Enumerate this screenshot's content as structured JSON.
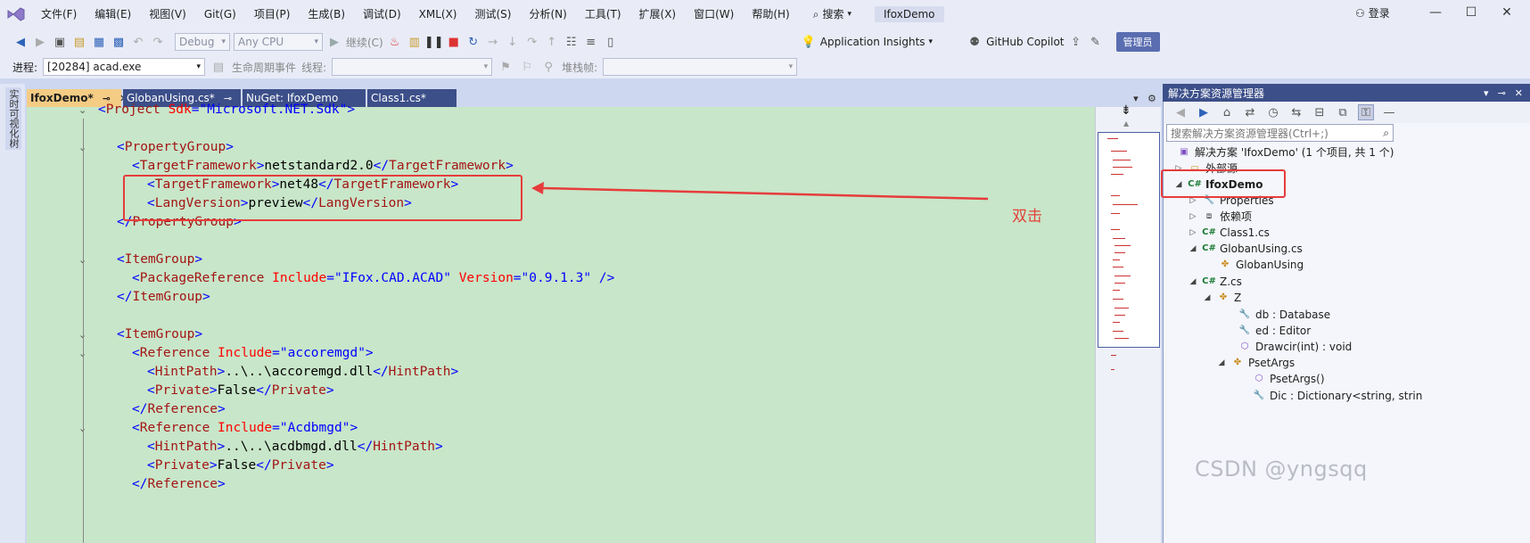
{
  "menubar": {
    "items": [
      "文件(F)",
      "编辑(E)",
      "视图(V)",
      "Git(G)",
      "项目(P)",
      "生成(B)",
      "调试(D)",
      "XML(X)",
      "测试(S)",
      "分析(N)",
      "工具(T)",
      "扩展(X)",
      "窗口(W)",
      "帮助(H)"
    ],
    "search_label": "搜索",
    "solution_title": "IfoxDemo",
    "login_label": "登录"
  },
  "toolbar1": {
    "config": "Debug",
    "platform": "Any CPU",
    "continue_label": "继续(C)",
    "insights_label": "Application Insights",
    "copilot_label": "GitHub Copilot",
    "admin_label": "管理员"
  },
  "toolbar2": {
    "process_label": "进程:",
    "process_value": "[20284] acad.exe",
    "lifecycle_label": "生命周期事件",
    "thread_label": "线程:",
    "stack_label": "堆栈帧:"
  },
  "left_strip": {
    "label": "实时可视化树"
  },
  "tabs": [
    {
      "label": "IfoxDemo*",
      "active": true
    },
    {
      "label": "GlobanUsing.cs*",
      "active": false
    },
    {
      "label": "NuGet: IfoxDemo",
      "active": false
    },
    {
      "label": "Class1.cs*",
      "active": false
    }
  ],
  "code": {
    "l1_tag": "Project",
    "l1_attr": "Sdk",
    "l1_val": "\"Microsoft.NET.Sdk\"",
    "l3_tag": "PropertyGroup",
    "l4_tag": "TargetFramework",
    "l4_text": "netstandard2.0",
    "l5_tag": "TargetFramework",
    "l5_text": "net48",
    "l6_tag": "LangVersion",
    "l6_text": "preview",
    "l7_tag": "PropertyGroup",
    "l9_tag": "ItemGroup",
    "l10_tag": "PackageReference",
    "l10_attr1": "Include",
    "l10_val1": "\"IFox.CAD.ACAD\"",
    "l10_attr2": "Version",
    "l10_val2": "\"0.9.1.3\"",
    "l11_tag": "ItemGroup",
    "l13_tag": "ItemGroup",
    "l14_tag": "Reference",
    "l14_attr": "Include",
    "l14_val": "\"accoremgd\"",
    "l15_tag": "HintPath",
    "l15_text": "..\\..\\accoremgd.dll",
    "l16_tag": "Private",
    "l16_text": "False",
    "l17_tag": "Reference",
    "l18_tag": "Reference",
    "l18_attr": "Include",
    "l18_val": "\"Acdbmgd\"",
    "l19_tag": "HintPath",
    "l19_text": "..\\..\\acdbmgd.dll",
    "l20_tag": "Private",
    "l20_text": "False",
    "l21_tag": "Reference"
  },
  "solution_explorer": {
    "title": "解决方案资源管理器",
    "search_placeholder": "搜索解决方案资源管理器(Ctrl+;)",
    "items": [
      {
        "label": "解决方案 'IfoxDemo' (1 个项目, 共 1 个)",
        "icon": "solution-icon"
      },
      {
        "label": "外部源",
        "icon": "folder-icon"
      },
      {
        "label": "IfoxDemo",
        "icon": "csproj-icon"
      },
      {
        "label": "Properties",
        "icon": "wrench-icon"
      },
      {
        "label": "依赖项",
        "icon": "dependencies-icon"
      },
      {
        "label": "Class1.cs",
        "icon": "csharp-file-icon"
      },
      {
        "label": "GlobanUsing.cs",
        "icon": "csharp-file-icon"
      },
      {
        "label": "GlobanUsing",
        "icon": "class-icon"
      },
      {
        "label": "Z.cs",
        "icon": "csharp-file-icon"
      },
      {
        "label": "Z",
        "icon": "class-icon"
      },
      {
        "label": "db : Database",
        "icon": "property-icon"
      },
      {
        "label": "ed : Editor",
        "icon": "property-icon"
      },
      {
        "label": "Drawcir(int) : void",
        "icon": "method-icon"
      },
      {
        "label": "PsetArgs",
        "icon": "class-icon"
      },
      {
        "label": "PsetArgs()",
        "icon": "method-icon"
      },
      {
        "label": "Dic : Dictionary<string, strin",
        "icon": "property-icon"
      }
    ]
  },
  "annotation": {
    "text": "双击"
  },
  "watermark": "CSDN @yngsqq"
}
